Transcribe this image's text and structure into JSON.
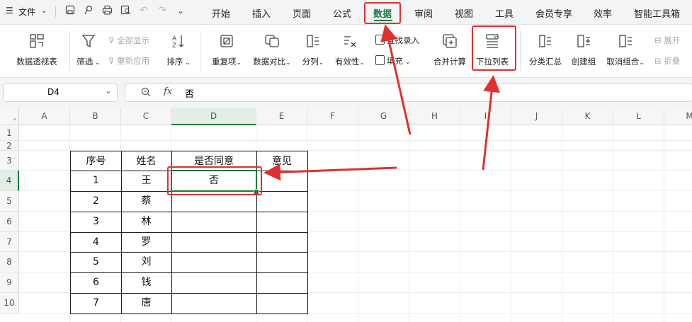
{
  "menubar": {
    "file_label": "文件",
    "tabs": [
      "开始",
      "插入",
      "页面",
      "公式",
      "数据",
      "审阅",
      "视图",
      "工具",
      "会员专享",
      "效率",
      "智能工具箱"
    ],
    "active_tab": "数据"
  },
  "ribbon": {
    "pivot": "数据透视表",
    "filter": "筛选",
    "show_all": "全部显示",
    "reapply": "重新应用",
    "sort": "排序",
    "duplicates": "重复项",
    "compare": "数据对比",
    "split_column": "分列",
    "validity": "有效性",
    "find_entry": "查找录入",
    "fill": "填充",
    "consolidate": "合并计算",
    "dropdown_list": "下拉列表",
    "subtotal": "分类汇总",
    "create_group": "创建组",
    "ungroup": "取消组合",
    "expand": "展开",
    "collapse": "折叠"
  },
  "formula_bar": {
    "cell_ref": "D4",
    "fx": "fx",
    "content": "否"
  },
  "grid": {
    "columns": [
      "A",
      "B",
      "C",
      "D",
      "E",
      "F",
      "G",
      "H",
      "I",
      "J",
      "K",
      "L",
      "M"
    ],
    "rows": [
      "1",
      "2",
      "3",
      "4",
      "5",
      "6",
      "7",
      "8",
      "9",
      "10"
    ],
    "selected_column": "D",
    "selected_row": "4"
  },
  "table": {
    "headers": [
      "序号",
      "姓名",
      "是否同意",
      "意见"
    ],
    "rows": [
      [
        "1",
        "王",
        "否",
        ""
      ],
      [
        "2",
        "蔡",
        "",
        ""
      ],
      [
        "3",
        "林",
        "",
        ""
      ],
      [
        "4",
        "罗",
        "",
        ""
      ],
      [
        "5",
        "刘",
        "",
        ""
      ],
      [
        "6",
        "钱",
        "",
        ""
      ],
      [
        "7",
        "唐",
        "",
        ""
      ]
    ]
  },
  "colors": {
    "accent": "#1e7a3c",
    "highlight": "#e03030"
  }
}
